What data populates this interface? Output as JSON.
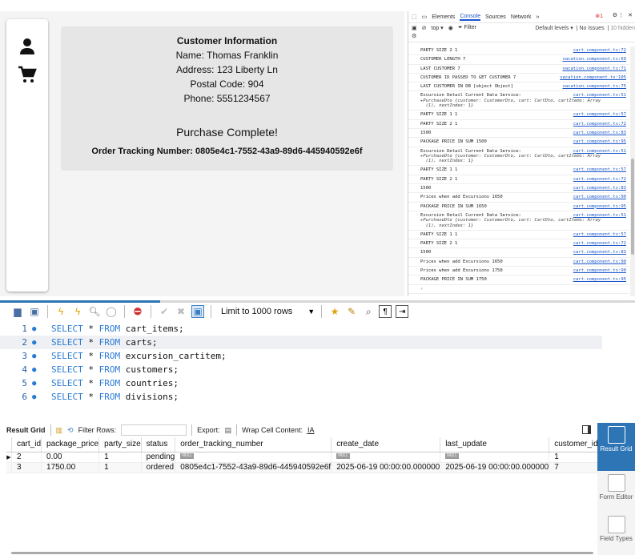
{
  "app": {
    "sidebar": {
      "icons": [
        "person-icon",
        "cart-icon"
      ]
    },
    "customer_card": {
      "title": "Customer Information",
      "name": "Name: Thomas Franklin",
      "address": "Address: 123 Liberty Ln",
      "postal": "Postal Code: 904",
      "phone": "Phone: 5551234567"
    },
    "purchase_card": {
      "heading": "Purchase Complete!",
      "tracking": "Order Tracking Number: 0805e4c1-7552-43a9-89d6-445940592e6f"
    }
  },
  "devtools": {
    "tabs": [
      "Elements",
      "Console",
      "Sources",
      "Network"
    ],
    "tabs_more": "»",
    "error_count": "1",
    "context": "top ▾",
    "filter_placeholder": "Filter",
    "levels": "Default levels ▾",
    "issues": "No Issues",
    "hidden": "10 hidden",
    "logs": [
      {
        "msg": "PARTY SIZE 2 1",
        "src": "cart.component.ts:72"
      },
      {
        "msg": "CUSTOMER LENGTH 7",
        "src": "vacation.component.ts:69"
      },
      {
        "msg": "LAST CUSTOMER 7",
        "src": "vacation.component.ts:71"
      },
      {
        "msg": "CUSTOMER ID PASSED TO GET CUSTOMER 7",
        "src": "vacation.component.ts:105"
      },
      {
        "msg": "LAST CUSTOMER IN DB [object Object]",
        "src": "vacation.component.ts:75"
      },
      {
        "msg": "Excursion Detail Current Data Service:",
        "src": "cart.component.ts:51",
        "obj": "▸PurchaseDto {customer: CustomerDto, cart: CartDto, cartItems: Array\n  (1), nextIndex: 1}"
      },
      {
        "msg": "PARTY SIZE 1 1",
        "src": "cart.component.ts:57"
      },
      {
        "msg": "PARTY SIZE 2 1",
        "src": "cart.component.ts:72"
      },
      {
        "msg": "1500",
        "src": "cart.component.ts:83"
      },
      {
        "msg": "PACKAGE PRICE IN SUM 1500",
        "src": "cart.component.ts:95"
      },
      {
        "msg": "Excursion Detail Current Data Service:",
        "src": "cart.component.ts:51",
        "obj": "▸PurchaseDto {customer: CustomerDto, cart: CartDto, cartItems: Array\n  (1), nextIndex: 1}"
      },
      {
        "msg": "PARTY SIZE 1 1",
        "src": "cart.component.ts:57"
      },
      {
        "msg": "PARTY SIZE 2 1",
        "src": "cart.component.ts:72"
      },
      {
        "msg": "1500",
        "src": "cart.component.ts:83"
      },
      {
        "msg": "Prices when add Excursions 1650",
        "src": "cart.component.ts:90"
      },
      {
        "msg": "PACKAGE PRICE IN SUM 1650",
        "src": "cart.component.ts:95"
      },
      {
        "msg": "Excursion Detail Current Data Service:",
        "src": "cart.component.ts:51",
        "obj": "▸PurchaseDto {customer: CustomerDto, cart: CartDto, cartItems: Array\n  (1), nextIndex: 1}"
      },
      {
        "msg": "PARTY SIZE 1 1",
        "src": "cart.component.ts:57"
      },
      {
        "msg": "PARTY SIZE 2 1",
        "src": "cart.component.ts:72"
      },
      {
        "msg": "1500",
        "src": "cart.component.ts:83"
      },
      {
        "msg": "Prices when add Excursions 1650",
        "src": "cart.component.ts:90"
      },
      {
        "msg": "Prices when add Excursions 1750",
        "src": "cart.component.ts:90"
      },
      {
        "msg": "PACKAGE PRICE IN SUM 1750",
        "src": "cart.component.ts:95"
      }
    ],
    "prompt": "›"
  },
  "workbench": {
    "limit_label": "Limit to 1000 rows",
    "editor_lines": [
      {
        "num": "1",
        "kw1": "SELECT",
        "mid": " * ",
        "kw2": "FROM",
        "rest": " cart_items;"
      },
      {
        "num": "2",
        "kw1": "SELECT",
        "mid": " * ",
        "kw2": "FROM",
        "rest": " carts;"
      },
      {
        "num": "3",
        "kw1": "SELECT",
        "mid": " * ",
        "kw2": "FROM",
        "rest": " excursion_cartitem;"
      },
      {
        "num": "4",
        "kw1": "SELECT",
        "mid": " * ",
        "kw2": "FROM",
        "rest": " customers;"
      },
      {
        "num": "5",
        "kw1": "SELECT",
        "mid": " * ",
        "kw2": "FROM",
        "rest": " countries;"
      },
      {
        "num": "6",
        "kw1": "SELECT",
        "mid": " * ",
        "kw2": "FROM",
        "rest": " divisions;"
      }
    ],
    "result_toolbar": {
      "result_grid": "Result Grid",
      "filter_rows": "Filter Rows:",
      "export": "Export:",
      "wrap": "Wrap Cell Content:"
    },
    "columns": [
      "cart_id",
      "package_price",
      "party_size",
      "status",
      "order_tracking_number",
      "create_date",
      "last_update",
      "customer_id"
    ],
    "rows": [
      [
        "2",
        "0.00",
        "1",
        "pending",
        "NULL",
        "NULL",
        "NULL",
        "1"
      ],
      [
        "3",
        "1750.00",
        "1",
        "ordered",
        "0805e4c1-7552-43a9-89d6-445940592e6f",
        "2025-06-19 00:00:00.000000",
        "2025-06-19 00:00:00.000000",
        "7"
      ]
    ],
    "side_panel": {
      "result_grid": "Result Grid",
      "form_editor": "Form Editor",
      "field_types": "Field Types"
    }
  }
}
